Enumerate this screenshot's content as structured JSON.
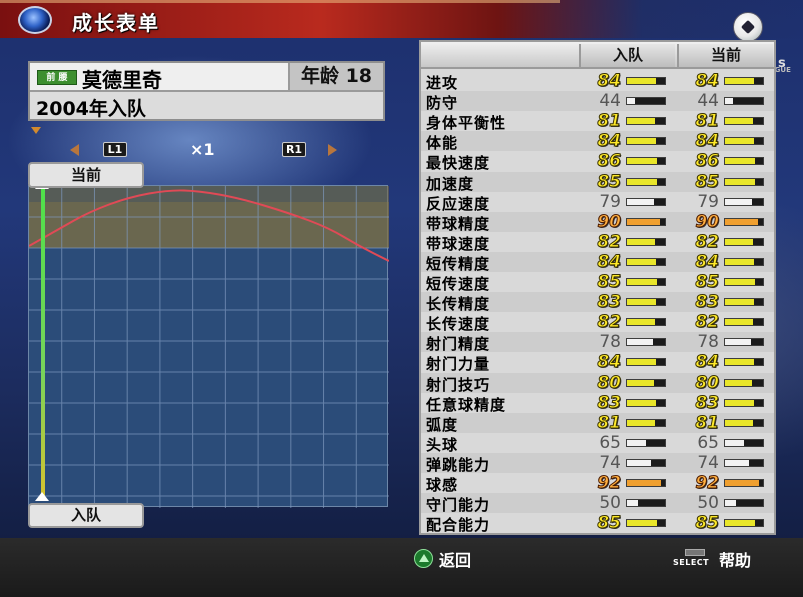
{
  "header": {
    "title": "成长表单"
  },
  "side_text": {
    "letter": "s",
    "league": "LEAGUE"
  },
  "player": {
    "position_badge": "前 腰",
    "name": "莫德里奇",
    "age_text": "年龄 18",
    "join_text": "2004年入队"
  },
  "graph": {
    "left_button": "L1",
    "right_button": "R1",
    "zoom": "×1",
    "current_tag": "当前",
    "joined_tag": "入队",
    "curve_color": "#e04a56",
    "marker_color": "#4ee04a"
  },
  "stats": {
    "col_joined": "入队",
    "col_current": "当前",
    "rows": [
      {
        "label": "进攻",
        "joined": "84",
        "current": "84"
      },
      {
        "label": "防守",
        "joined": "44",
        "current": "44"
      },
      {
        "label": "身体平衡性",
        "joined": "81",
        "current": "81"
      },
      {
        "label": "体能",
        "joined": "84",
        "current": "84"
      },
      {
        "label": "最快速度",
        "joined": "86",
        "current": "86"
      },
      {
        "label": "加速度",
        "joined": "85",
        "current": "85"
      },
      {
        "label": "反应速度",
        "joined": "79",
        "current": "79"
      },
      {
        "label": "带球精度",
        "joined": "90",
        "current": "90"
      },
      {
        "label": "带球速度",
        "joined": "82",
        "current": "82"
      },
      {
        "label": "短传精度",
        "joined": "84",
        "current": "84"
      },
      {
        "label": "短传速度",
        "joined": "85",
        "current": "85"
      },
      {
        "label": "长传精度",
        "joined": "83",
        "current": "83"
      },
      {
        "label": "长传速度",
        "joined": "82",
        "current": "82"
      },
      {
        "label": "射门精度",
        "joined": "78",
        "current": "78"
      },
      {
        "label": "射门力量",
        "joined": "84",
        "current": "84"
      },
      {
        "label": "射门技巧",
        "joined": "80",
        "current": "80"
      },
      {
        "label": "任意球精度",
        "joined": "83",
        "current": "83"
      },
      {
        "label": "弧度",
        "joined": "81",
        "current": "81"
      },
      {
        "label": "头球",
        "joined": "65",
        "current": "65"
      },
      {
        "label": "弹跳能力",
        "joined": "74",
        "current": "74"
      },
      {
        "label": "球感",
        "joined": "92",
        "current": "92"
      },
      {
        "label": "守门能力",
        "joined": "50",
        "current": "50"
      },
      {
        "label": "配合能力",
        "joined": "85",
        "current": "85"
      }
    ],
    "colors": {
      "high": "#e9e62a",
      "top": "#f0a030",
      "low": "#f2f2f2"
    }
  },
  "footer": {
    "back_label": "返回",
    "select_key": "SELECT",
    "help_label": "帮助"
  }
}
